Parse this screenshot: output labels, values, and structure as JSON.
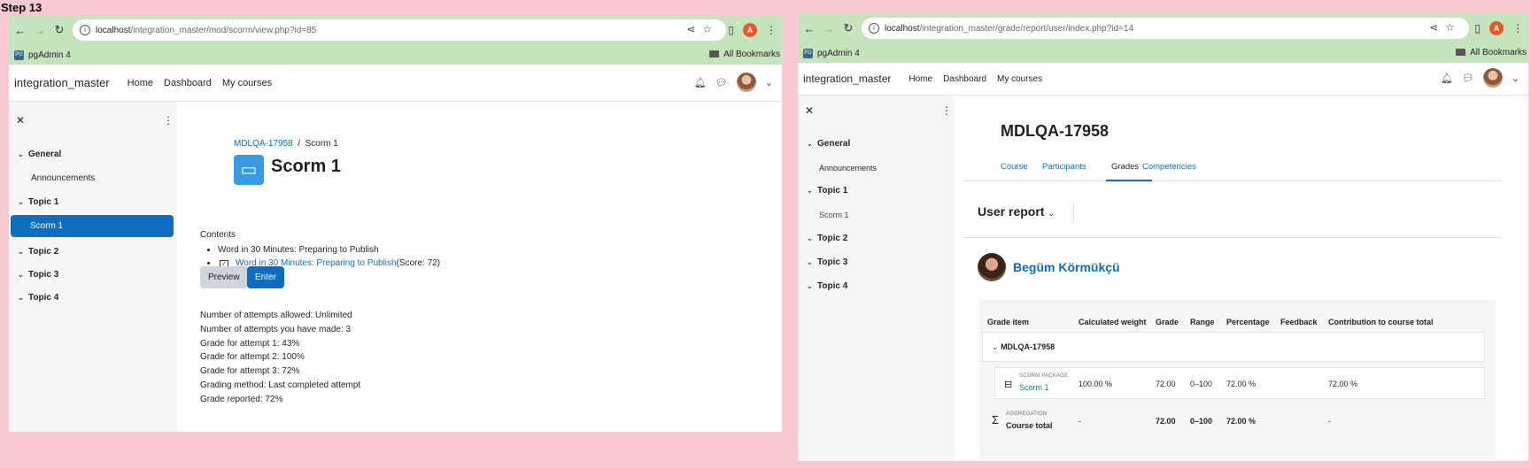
{
  "step_label": "Step 13",
  "left": {
    "url_host": "localhost",
    "url_path": "/integration_master/mod/scorm/view.php?id=85",
    "bookmark": "pgAdmin 4",
    "all_bookmarks": "All Bookmarks",
    "profile_initial": "A",
    "site_name": "integration_master",
    "nav": [
      "Home",
      "Dashboard",
      "My courses"
    ],
    "drawer": {
      "sections": [
        "General",
        "Topic 1",
        "Topic 2",
        "Topic 3",
        "Topic 4"
      ],
      "activities": [
        "Announcements",
        "Scorm 1"
      ]
    },
    "breadcrumb": {
      "course": "MDLQA-17958",
      "sep": "/",
      "current": "Scorm 1"
    },
    "title": "Scorm 1",
    "contents_label": "Contents",
    "toc_item": "Word in 30 Minutes: Preparing to Publish",
    "toc_sub_link": "Word in 30 Minutes: Preparing to Publish",
    "toc_sub_score": "(Score: 72)",
    "preview_label": "Preview",
    "enter_label": "Enter",
    "info": [
      "Number of attempts allowed: Unlimited",
      "Number of attempts you have made: 3",
      "Grade for attempt 1: 43%",
      "Grade for attempt 2: 100%",
      "Grade for attempt 3: 72%",
      "Grading method: Last completed attempt",
      "Grade reported: 72%"
    ]
  },
  "right": {
    "url_host": "localhost",
    "url_path": "/integration_master/grade/report/user/index.php?id=14",
    "bookmark": "pgAdmin 4",
    "all_bookmarks": "All Bookmarks",
    "profile_initial": "A",
    "site_name": "integration_master",
    "nav": [
      "Home",
      "Dashboard",
      "My courses"
    ],
    "drawer": {
      "sections": [
        "General",
        "Topic 1",
        "Topic 2",
        "Topic 3",
        "Topic 4"
      ],
      "activities": [
        "Announcements",
        "Scorm 1"
      ]
    },
    "course_title": "MDLQA-17958",
    "tabs": [
      "Course",
      "Participants",
      "Grades",
      "Competencies"
    ],
    "report_selector": "User report",
    "user_name": "Begüm Körmükçü",
    "table": {
      "headers": [
        "Grade item",
        "Calculated weight",
        "Grade",
        "Range",
        "Percentage",
        "Feedback",
        "Contribution to course total"
      ],
      "group": "MDLQA-17958",
      "item": {
        "type": "SCORM PACKAGE",
        "name": "Scorm 1",
        "weight": "100.00 %",
        "grade": "72.00",
        "range": "0–100",
        "percentage": "72.00 %",
        "feedback": "",
        "contribution": "72.00 %"
      },
      "total": {
        "type": "AGGREGATION",
        "name": "Course total",
        "weight": "-",
        "grade": "72.00",
        "range": "0–100",
        "percentage": "72.00 %",
        "feedback": "",
        "contribution": "-"
      }
    }
  }
}
